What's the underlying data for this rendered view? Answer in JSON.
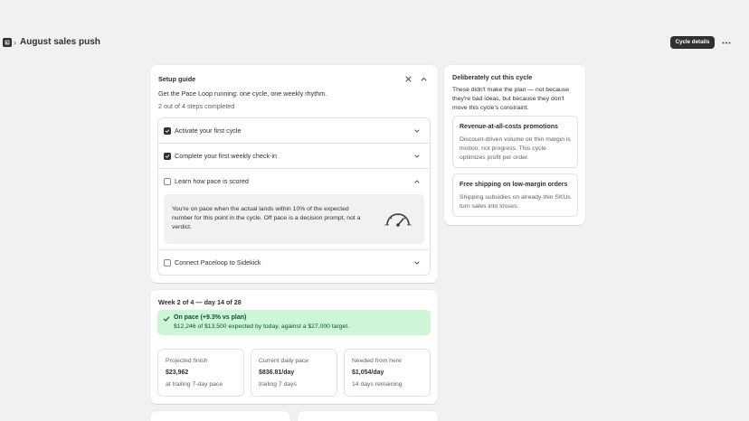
{
  "header": {
    "app_icon": "paceloop-app-icon",
    "breadcrumb_separator": "›",
    "title": "August sales push",
    "cycle_details_label": "Cycle details",
    "more_label": "•••"
  },
  "setup_guide": {
    "title": "Setup guide",
    "intro": "Get the Pace Loop running: one cycle, one weekly rhythm.",
    "progress": "2 out of 4 steps completed",
    "steps_completed": 2,
    "steps_total": 4,
    "steps": [
      {
        "label": "Activate your first cycle",
        "checked": true,
        "expanded": false
      },
      {
        "label": "Complete your first weekly check-in",
        "checked": true,
        "expanded": false
      },
      {
        "label": "Learn how pace is scored",
        "checked": false,
        "expanded": true,
        "detail": "You're on pace when the actual lands within 10% of the expected number for this point in the cycle. Off pace is a decision prompt, not a verdict."
      },
      {
        "label": "Connect Paceloop to Sidekick",
        "checked": false,
        "expanded": false
      }
    ]
  },
  "cut": {
    "title": "Deliberately cut this cycle",
    "description": "These didn't make the plan — not because they're bad ideas, but because they don't move this cycle's constraint.",
    "items": [
      {
        "title": "Revenue-at-all-costs promotions",
        "body": "Discount-driven volume on thin margin is motion, not progress. This cycle optimizes profit per order."
      },
      {
        "title": "Free shipping on low-margin orders",
        "body": "Shipping subsidies on already-thin SKUs turn sales into losses."
      }
    ]
  },
  "week": {
    "title": "Week 2 of 4 — day 14 of 28",
    "status_title": "On pace (+9.3% vs plan)",
    "status_sub": "$12,246 of $13,500 expected by today, against a $27,000 target.",
    "metrics": [
      {
        "label": "Projected finish",
        "value": "$23,962",
        "sub": "at trailing 7-day pace"
      },
      {
        "label": "Current daily pace",
        "value": "$836.81/day",
        "sub": "trailing 7 days"
      },
      {
        "label": "Needed from here",
        "value": "$1,054/day",
        "sub": "14 days remaining"
      }
    ]
  },
  "colors": {
    "primary_button": "#303030",
    "success_bg": "#cdf6d6",
    "success_text": "#0c5132",
    "page_bg": "#f1f1f1"
  }
}
